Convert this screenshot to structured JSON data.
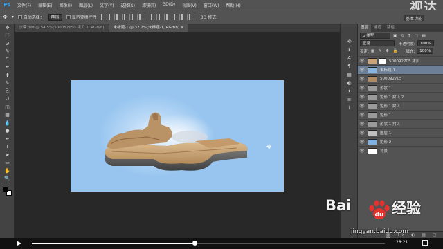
{
  "menu": {
    "logo": "Ps",
    "items": [
      "文件(F)",
      "编辑(E)",
      "图像(I)",
      "图层(L)",
      "文字(Y)",
      "选择(S)",
      "滤镜(T)",
      "3D(D)",
      "视图(V)",
      "窗口(W)",
      "帮助(H)"
    ]
  },
  "watermark_top": "视达",
  "options": {
    "auto_select_label": "自动选择：",
    "auto_select_value": "图层",
    "transform_label": "显示变换控件",
    "workspace": "基本功能"
  },
  "tabs": [
    {
      "label": "沙漠.psd @ 54.5%(500052650 拷贝 2, RGB/8)",
      "active": false
    },
    {
      "label": "未标题-1 @ 32.2%(未标题-1, RGB/8) ×",
      "active": true
    }
  ],
  "tools": [
    "move-tool",
    "marquee-tool",
    "lasso-tool",
    "quick-select-tool",
    "crop-tool",
    "eyedropper-tool",
    "healing-tool",
    "brush-tool",
    "stamp-tool",
    "history-brush-tool",
    "eraser-tool",
    "gradient-tool",
    "blur-tool",
    "dodge-tool",
    "pen-tool",
    "type-tool",
    "path-select-tool",
    "shape-tool",
    "hand-tool",
    "zoom-tool"
  ],
  "layers_panel": {
    "tabs": [
      "图层",
      "通道",
      "路径"
    ],
    "filter": "ρ 类型",
    "blend_mode": "正常",
    "opacity_label": "不透明度:",
    "opacity": "100%",
    "lock_label": "锁定:",
    "fill_label": "填充:",
    "fill": "100%",
    "layers": [
      {
        "name": "500092705 拷贝",
        "selected": false,
        "thumb": "#c7a57b",
        "mask": true
      },
      {
        "name": "未标题-1",
        "selected": true,
        "thumb": "#8ab4de",
        "mask": false
      },
      {
        "name": "500092705",
        "selected": false,
        "thumb": "#b08a62",
        "mask": false
      },
      {
        "name": "形状 1",
        "selected": false,
        "thumb": "#9a9a9a",
        "mask": false
      },
      {
        "name": "矩形 1 拷贝 2",
        "selected": false,
        "thumb": "#9a9a9a",
        "mask": false
      },
      {
        "name": "矩形 1 拷贝",
        "selected": false,
        "thumb": "#9a9a9a",
        "mask": false
      },
      {
        "name": "矩形 1",
        "selected": false,
        "thumb": "#9a9a9a",
        "mask": false
      },
      {
        "name": "形状 1 拷贝",
        "selected": false,
        "thumb": "#9a9a9a",
        "mask": false
      },
      {
        "name": "图层 1",
        "selected": false,
        "thumb": "#bfbfbf",
        "mask": false
      },
      {
        "name": "矩形 2",
        "selected": false,
        "thumb": "#7fb0e0",
        "mask": false
      },
      {
        "name": "背景",
        "selected": false,
        "thumb": "#ffffff",
        "mask": false
      }
    ]
  },
  "video": {
    "progress": 0.46,
    "time": "28:21"
  },
  "watermark": {
    "text": "Bai",
    "text2": "经验",
    "url": "jingyan.baidu.com"
  }
}
